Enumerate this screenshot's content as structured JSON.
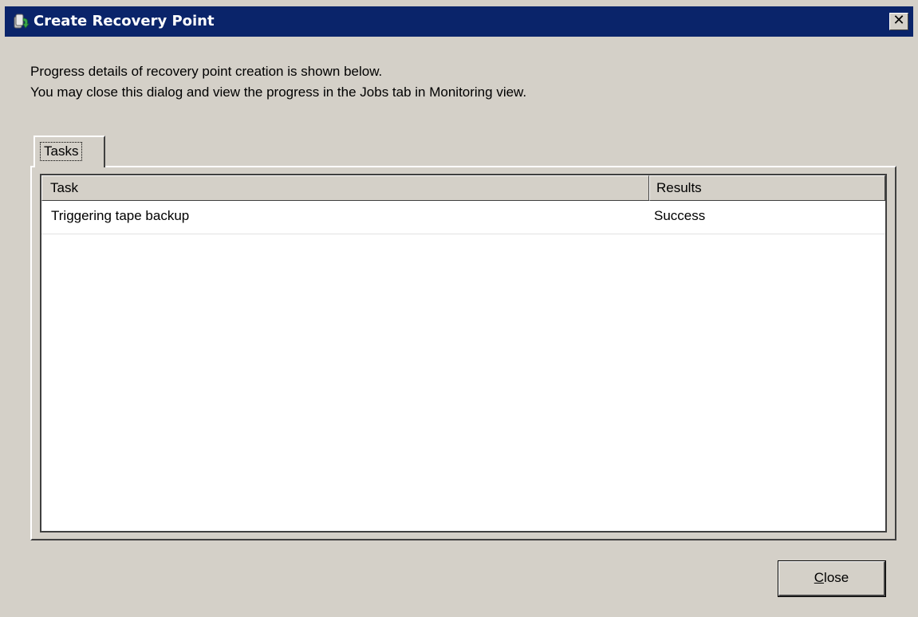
{
  "window": {
    "title": "Create Recovery Point",
    "close_glyph": "✕",
    "title_icon": "recovery-point-icon"
  },
  "description": {
    "line1": "Progress details of recovery point creation is shown below.",
    "line2": "You may close this dialog and view the progress in the Jobs tab in Monitoring view."
  },
  "tabs": [
    {
      "label": "Tasks",
      "selected": true
    }
  ],
  "table": {
    "columns": [
      "Task",
      "Results"
    ],
    "rows": [
      {
        "task": "Triggering tape backup",
        "result": "Success"
      }
    ]
  },
  "buttons": {
    "close_accel": "C",
    "close_rest": "lose"
  },
  "colors": {
    "titlebar": "#0a246a",
    "dialog_bg": "#d4d0c8"
  }
}
